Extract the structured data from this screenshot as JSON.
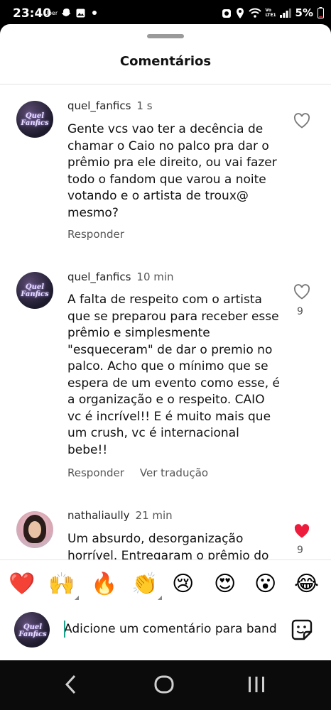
{
  "status_bar": {
    "time": "23:40",
    "app_label": "Uber",
    "battery": "5%",
    "network_label": "Vo LTE1"
  },
  "sheet": {
    "title": "Comentários"
  },
  "comments": [
    {
      "username": "quel_fanfics",
      "time": "1 s",
      "avatar_text": "Quel Fanfics",
      "text": "Gente vcs vao ter a decência de chamar o Caio no palco pra dar o prêmio pra ele direito, ou vai fazer todo o fandom que varou a noite votando e o artista de troux@ mesmo?",
      "reply_label": "Responder",
      "liked": false
    },
    {
      "username": "quel_fanfics",
      "time": "10 min",
      "avatar_text": "Quel Fanfics",
      "text": "A falta de respeito com o artista que se preparou para receber esse prêmio e simplesmente \"esqueceram\" de dar o premio no palco. Acho que o mínimo que se espera de um evento como esse, é a organização e o respeito. CAIO vc é incrível!! E é muito mais que um crush, vc é internacional bebe!!",
      "reply_label": "Responder",
      "translate_label": "Ver tradução",
      "likes": "9",
      "liked": false
    },
    {
      "username": "nathaliaully",
      "time": "21 min",
      "text": "Um absurdo, desorganização horrível. Entregaram o prêmio do",
      "likes": "9",
      "liked": true
    }
  ],
  "emoji_bar": [
    {
      "icon": "red-heart",
      "glyph": "❤️",
      "expandable": false
    },
    {
      "icon": "raising-hands",
      "glyph": "🙌",
      "expandable": true
    },
    {
      "icon": "fire",
      "glyph": "🔥",
      "expandable": false
    },
    {
      "icon": "clapping-hands",
      "glyph": "👏",
      "expandable": true
    },
    {
      "icon": "crying-face",
      "glyph": "😢",
      "expandable": false
    },
    {
      "icon": "heart-eyes-face",
      "glyph": "😍",
      "expandable": false
    },
    {
      "icon": "surprised-face",
      "glyph": "😮",
      "expandable": false
    },
    {
      "icon": "tears-of-joy-face",
      "glyph": "😂",
      "expandable": false
    }
  ],
  "input": {
    "placeholder": "Adicione um comentário para band",
    "avatar_text": "Quel Fanfics"
  },
  "colors": {
    "liked_heart": "#ed1c3c",
    "caret": "#1aa38a"
  }
}
